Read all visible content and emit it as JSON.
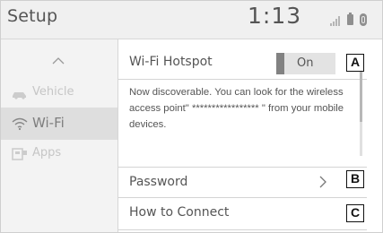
{
  "header": {
    "title": "Setup",
    "clock": "1:13",
    "icons": [
      "signal-icon",
      "battery-icon",
      "bluetooth-icon"
    ]
  },
  "sidebar": {
    "scroll_up_icon": "chevron-up-icon",
    "items": [
      {
        "label": "Vehicle",
        "icon": "car-icon",
        "state": "dimmed"
      },
      {
        "label": "Wi-Fi",
        "icon": "wifi-icon",
        "state": "selected"
      },
      {
        "label": "Apps",
        "icon": "apps-icon",
        "state": "dimmed"
      }
    ]
  },
  "content": {
    "hotspot": {
      "label": "Wi-Fi Hotspot",
      "toggle_value": "On"
    },
    "discoverable_text": "Now discoverable. You can look for the wireless access point\" ***************** \" from your mobile devices.",
    "password": {
      "label": "Password",
      "icon": "chevron-right-icon"
    },
    "how_to_connect": {
      "label": "How to Connect"
    }
  },
  "callouts": {
    "a": "A",
    "b": "B",
    "c": "C"
  },
  "colors": {
    "header_bg": "#f0f0f0",
    "sidebar_bg": "#f3f3f3",
    "selected_bg": "#dedede",
    "toggle_knob": "#828282"
  }
}
